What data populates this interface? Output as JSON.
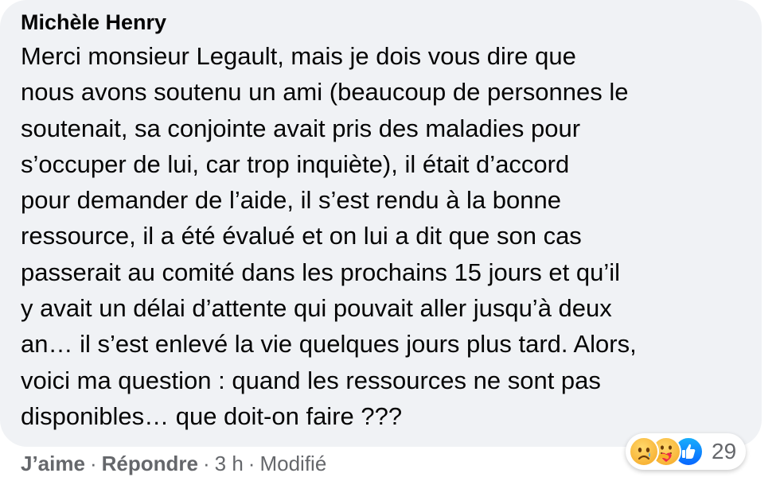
{
  "comment": {
    "author": "Michèle Henry",
    "text": "Merci monsieur Legault, mais je dois vous dire que\nnous avons soutenu un ami (beaucoup de personnes le\nsoutenait, sa conjointe avait pris des maladies pour\ns’occuper de lui, car trop inquiète), il était d’accord\npour demander de l’aide, il s’est rendu à la bonne\nressource, il a été évalué et on lui a dit que son cas\npasserait au comité dans les prochains 15 jours et qu’il\ny avait un délai d’attente qui pouvait aller jusqu’à deux\nan… il s’est enlevé la vie quelques jours plus tard. Alors,\nvoici ma question : quand les ressources ne sont pas\ndisponibles… que doit-on faire ???"
  },
  "reactions": {
    "icons": [
      "sad-emoji-icon",
      "care-emoji-icon",
      "like-thumb-icon"
    ],
    "count": "29"
  },
  "actions": {
    "like_label": "J’aime",
    "reply_label": "Répondre",
    "separator": "·",
    "time": "3 h",
    "edited": "Modifié"
  },
  "colors": {
    "bubble_bg": "#f0f2f5",
    "text": "#050505",
    "meta": "#65676b",
    "like_blue": "#0866ff",
    "emoji_yellow": "#f5a623"
  }
}
